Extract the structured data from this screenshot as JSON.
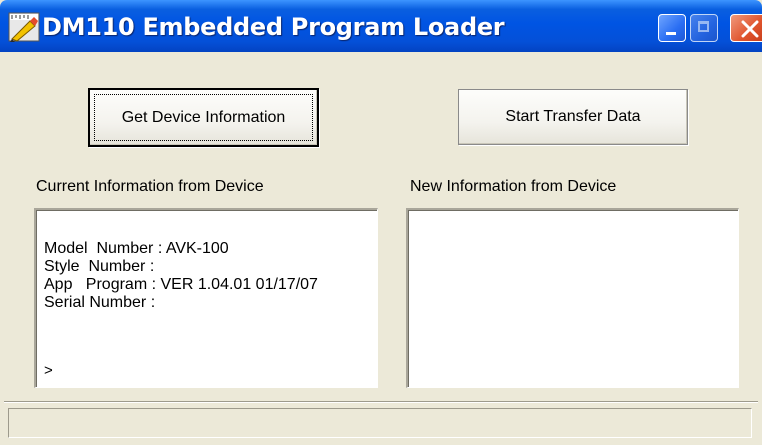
{
  "window": {
    "title": "DM110 Embedded Program Loader",
    "app_icon": "pencil-ruler-icon",
    "controls": {
      "minimize_icon": "minimize-icon",
      "maximize_icon": "maximize-icon",
      "close_icon": "close-icon"
    },
    "colors": {
      "titlebar": "#0054e3",
      "client": "#ece9d8",
      "close": "#e0542d"
    }
  },
  "buttons": {
    "get_device_info": "Get Device Information",
    "start_transfer": "Start Transfer Data"
  },
  "current_info": {
    "label": "Current Information from Device",
    "lines": [
      "Model  Number : AVK-100",
      "Style  Number :",
      "App   Program : VER 1.04.01 01/17/07",
      "Serial Number :"
    ],
    "prompt": ">"
  },
  "new_info": {
    "label": "New Information from Device",
    "lines": []
  },
  "status_bar": {
    "text": ""
  }
}
